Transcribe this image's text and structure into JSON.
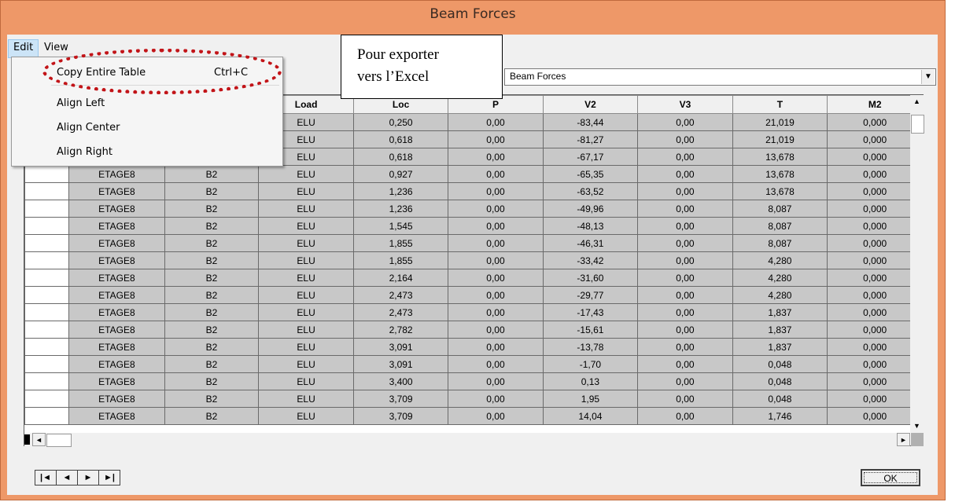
{
  "window": {
    "title": "Beam Forces"
  },
  "menubar": {
    "edit": "Edit",
    "view": "View"
  },
  "edit_menu": {
    "copy_label": "Copy Entire Table",
    "copy_shortcut": "Ctrl+C",
    "align_left": "Align Left",
    "align_center": "Align Center",
    "align_right": "Align Right"
  },
  "callout": {
    "line1": "Pour exporter",
    "line2": "vers l’Excel"
  },
  "table_select": {
    "value": "Beam Forces"
  },
  "columns": [
    "",
    "",
    "",
    "Load",
    "Loc",
    "P",
    "V2",
    "V3",
    "T",
    "M2"
  ],
  "rows": [
    [
      "",
      "",
      "",
      "ELU",
      "0,250",
      "0,00",
      "-83,44",
      "0,00",
      "21,019",
      "0,000"
    ],
    [
      "",
      "",
      "",
      "ELU",
      "0,618",
      "0,00",
      "-81,27",
      "0,00",
      "21,019",
      "0,000"
    ],
    [
      "",
      "",
      "",
      "ELU",
      "0,618",
      "0,00",
      "-67,17",
      "0,00",
      "13,678",
      "0,000"
    ],
    [
      "",
      "ETAGE8",
      "B2",
      "ELU",
      "0,927",
      "0,00",
      "-65,35",
      "0,00",
      "13,678",
      "0,000"
    ],
    [
      "",
      "ETAGE8",
      "B2",
      "ELU",
      "1,236",
      "0,00",
      "-63,52",
      "0,00",
      "13,678",
      "0,000"
    ],
    [
      "",
      "ETAGE8",
      "B2",
      "ELU",
      "1,236",
      "0,00",
      "-49,96",
      "0,00",
      "8,087",
      "0,000"
    ],
    [
      "",
      "ETAGE8",
      "B2",
      "ELU",
      "1,545",
      "0,00",
      "-48,13",
      "0,00",
      "8,087",
      "0,000"
    ],
    [
      "",
      "ETAGE8",
      "B2",
      "ELU",
      "1,855",
      "0,00",
      "-46,31",
      "0,00",
      "8,087",
      "0,000"
    ],
    [
      "",
      "ETAGE8",
      "B2",
      "ELU",
      "1,855",
      "0,00",
      "-33,42",
      "0,00",
      "4,280",
      "0,000"
    ],
    [
      "",
      "ETAGE8",
      "B2",
      "ELU",
      "2,164",
      "0,00",
      "-31,60",
      "0,00",
      "4,280",
      "0,000"
    ],
    [
      "",
      "ETAGE8",
      "B2",
      "ELU",
      "2,473",
      "0,00",
      "-29,77",
      "0,00",
      "4,280",
      "0,000"
    ],
    [
      "",
      "ETAGE8",
      "B2",
      "ELU",
      "2,473",
      "0,00",
      "-17,43",
      "0,00",
      "1,837",
      "0,000"
    ],
    [
      "",
      "ETAGE8",
      "B2",
      "ELU",
      "2,782",
      "0,00",
      "-15,61",
      "0,00",
      "1,837",
      "0,000"
    ],
    [
      "",
      "ETAGE8",
      "B2",
      "ELU",
      "3,091",
      "0,00",
      "-13,78",
      "0,00",
      "1,837",
      "0,000"
    ],
    [
      "",
      "ETAGE8",
      "B2",
      "ELU",
      "3,091",
      "0,00",
      "-1,70",
      "0,00",
      "0,048",
      "0,000"
    ],
    [
      "",
      "ETAGE8",
      "B2",
      "ELU",
      "3,400",
      "0,00",
      "0,13",
      "0,00",
      "0,048",
      "0,000"
    ],
    [
      "",
      "ETAGE8",
      "B2",
      "ELU",
      "3,709",
      "0,00",
      "1,95",
      "0,00",
      "0,048",
      "0,000"
    ],
    [
      "",
      "ETAGE8",
      "B2",
      "ELU",
      "3,709",
      "0,00",
      "14,04",
      "0,00",
      "1,746",
      "0,000"
    ]
  ],
  "buttons": {
    "ok": "OK"
  },
  "icons": {
    "nav_first": "first-record-icon",
    "nav_prev": "previous-record-icon",
    "nav_next": "next-record-icon",
    "nav_last": "last-record-icon",
    "combo": "chevron-down-icon"
  },
  "colors": {
    "title_bar": "#ee9868",
    "annotation": "#c21418",
    "menu_highlight": "#cce4f7"
  }
}
